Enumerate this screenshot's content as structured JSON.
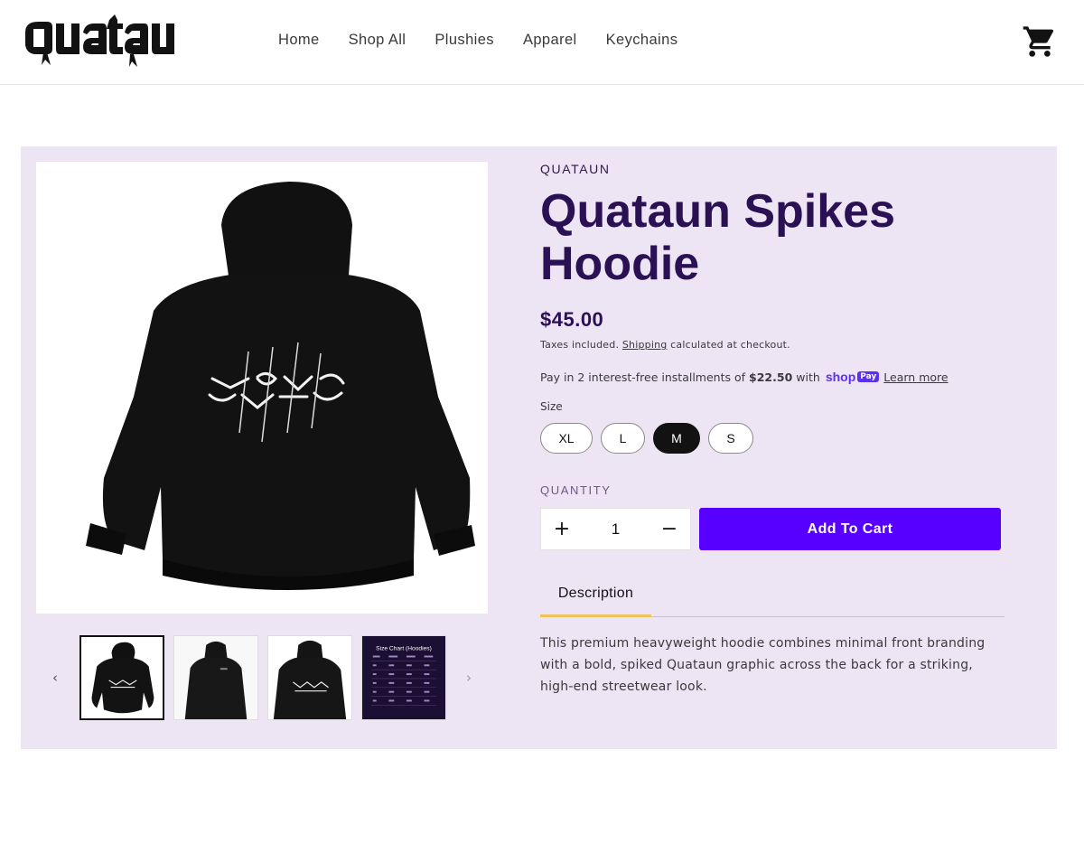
{
  "header": {
    "logo_text": "quataun",
    "nav": [
      "Home",
      "Shop All",
      "Plushies",
      "Apparel",
      "Keychains"
    ],
    "cart_icon": "cart-icon"
  },
  "gallery": {
    "main_image": "hoodie-back-black",
    "prev_icon": "chevron-left-icon",
    "next_icon": "chevron-right-icon",
    "thumbnails": [
      "hoodie-back-black",
      "model-front-hoodie",
      "model-back-hoodie",
      "size-chart"
    ],
    "active_thumbnail": 0,
    "size_chart_title": "Size Chart (Hoodies)"
  },
  "product": {
    "vendor": "QUATAUN",
    "title": "Quataun Spikes Hoodie",
    "price": "$45.00",
    "tax_prefix": "Taxes included.",
    "tax_link": "Shipping",
    "tax_suffix": "calculated at checkout.",
    "installments_prefix": "Pay in 2 interest-free installments of",
    "installments_amount": "$22.50",
    "installments_with": "with",
    "shop_pay_word": "shop",
    "shop_pay_chip": "Pay",
    "learn_more": "Learn more",
    "size_label": "Size",
    "sizes": [
      "XL",
      "L",
      "M",
      "S"
    ],
    "selected_size": "M",
    "quantity_label": "QUANTITY",
    "quantity_plus": "+",
    "quantity_value": "1",
    "quantity_minus": "−",
    "add_to_cart": "Add To Cart",
    "description_tab": "Description",
    "description": "This premium heavyweight hoodie combines minimal front branding with a bold, spiked Quataun graphic across the back for a striking, high-end streetwear look."
  },
  "colors": {
    "panel_bg": "#ede4f4",
    "title": "#2a1154",
    "accent_button": "#5800ff",
    "tab_underline": "#f0c25a",
    "shop_pay": "#5a31f4"
  }
}
